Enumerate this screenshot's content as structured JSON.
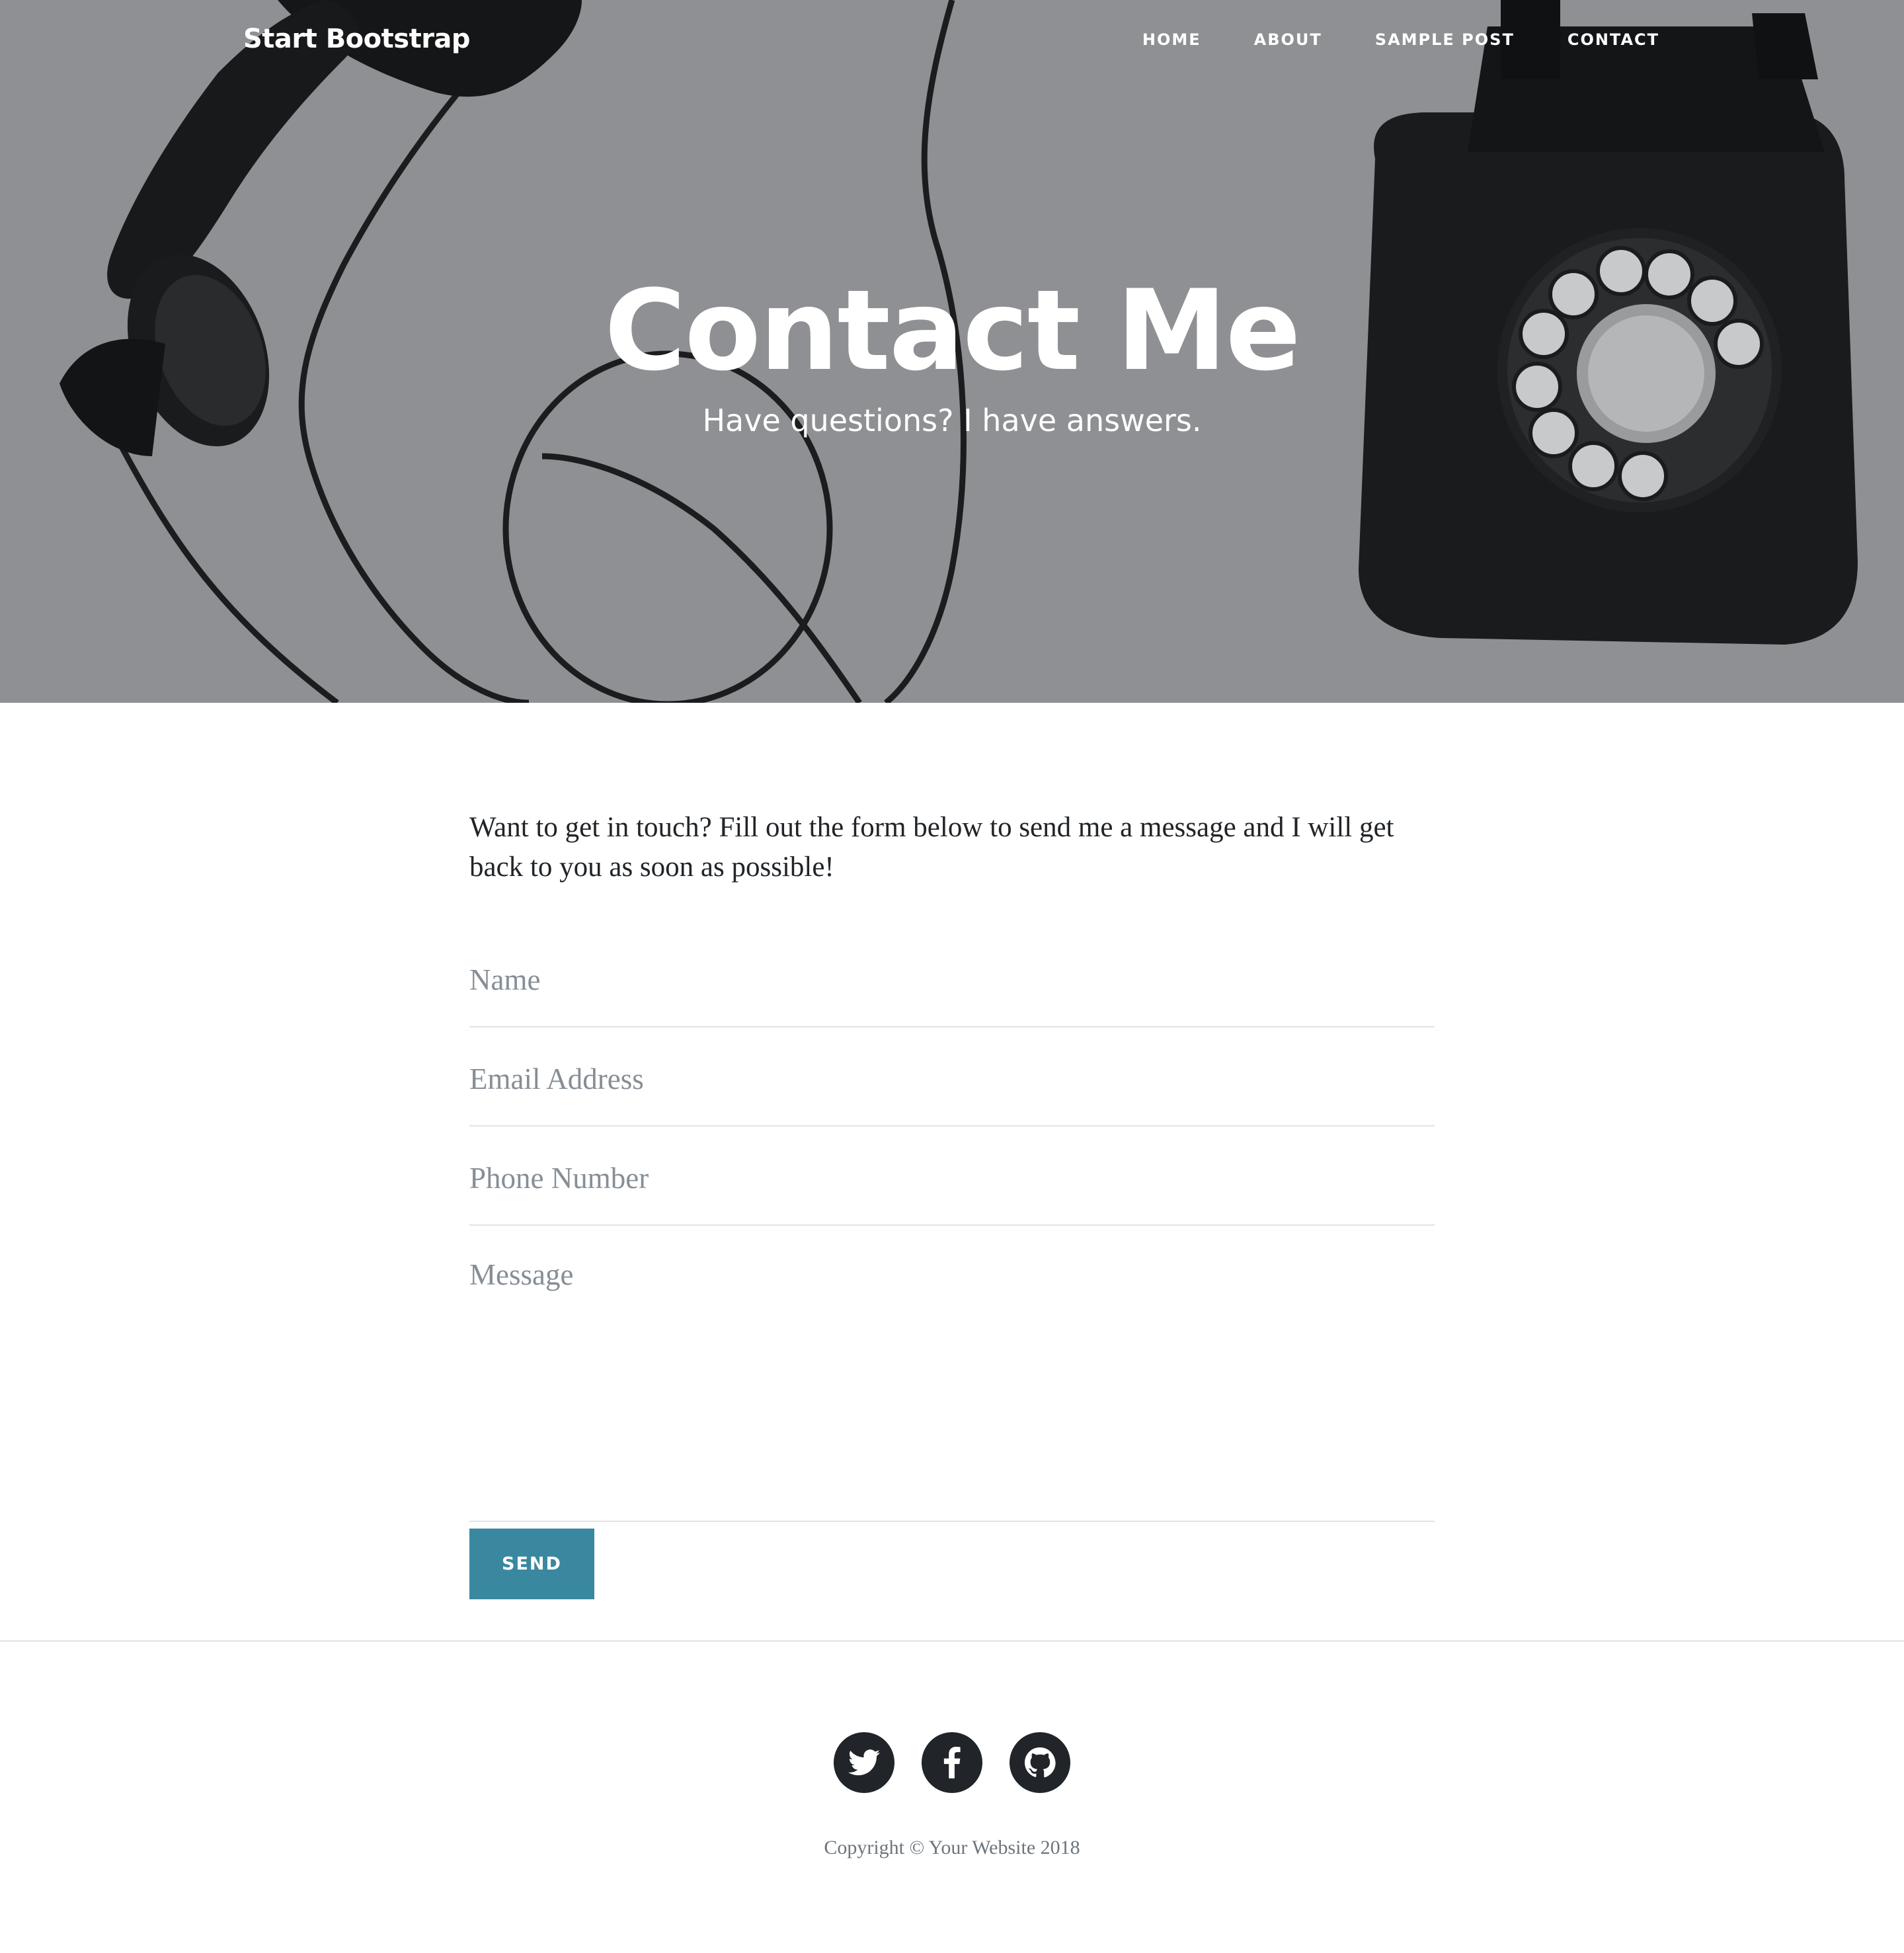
{
  "nav": {
    "brand": "Start Bootstrap",
    "links": [
      {
        "label": "HOME"
      },
      {
        "label": "ABOUT"
      },
      {
        "label": "SAMPLE POST"
      },
      {
        "label": "CONTACT"
      }
    ]
  },
  "hero": {
    "heading": "Contact Me",
    "subheading": "Have questions? I have answers.",
    "background_image": "rotary telephone photo with gray overlay",
    "overlay_color": "#8f9093"
  },
  "main": {
    "intro": "Want to get in touch? Fill out the form below to send me a message and I will get back to you as soon as possible!",
    "form": {
      "name_placeholder": "Name",
      "email_placeholder": "Email Address",
      "phone_placeholder": "Phone Number",
      "message_placeholder": "Message",
      "send_label": "SEND",
      "send_color": "#3a88a0"
    }
  },
  "footer": {
    "social": [
      {
        "icon": "twitter-icon"
      },
      {
        "icon": "facebook-icon"
      },
      {
        "icon": "github-icon"
      }
    ],
    "copyright": "Copyright © Your Website 2018"
  }
}
